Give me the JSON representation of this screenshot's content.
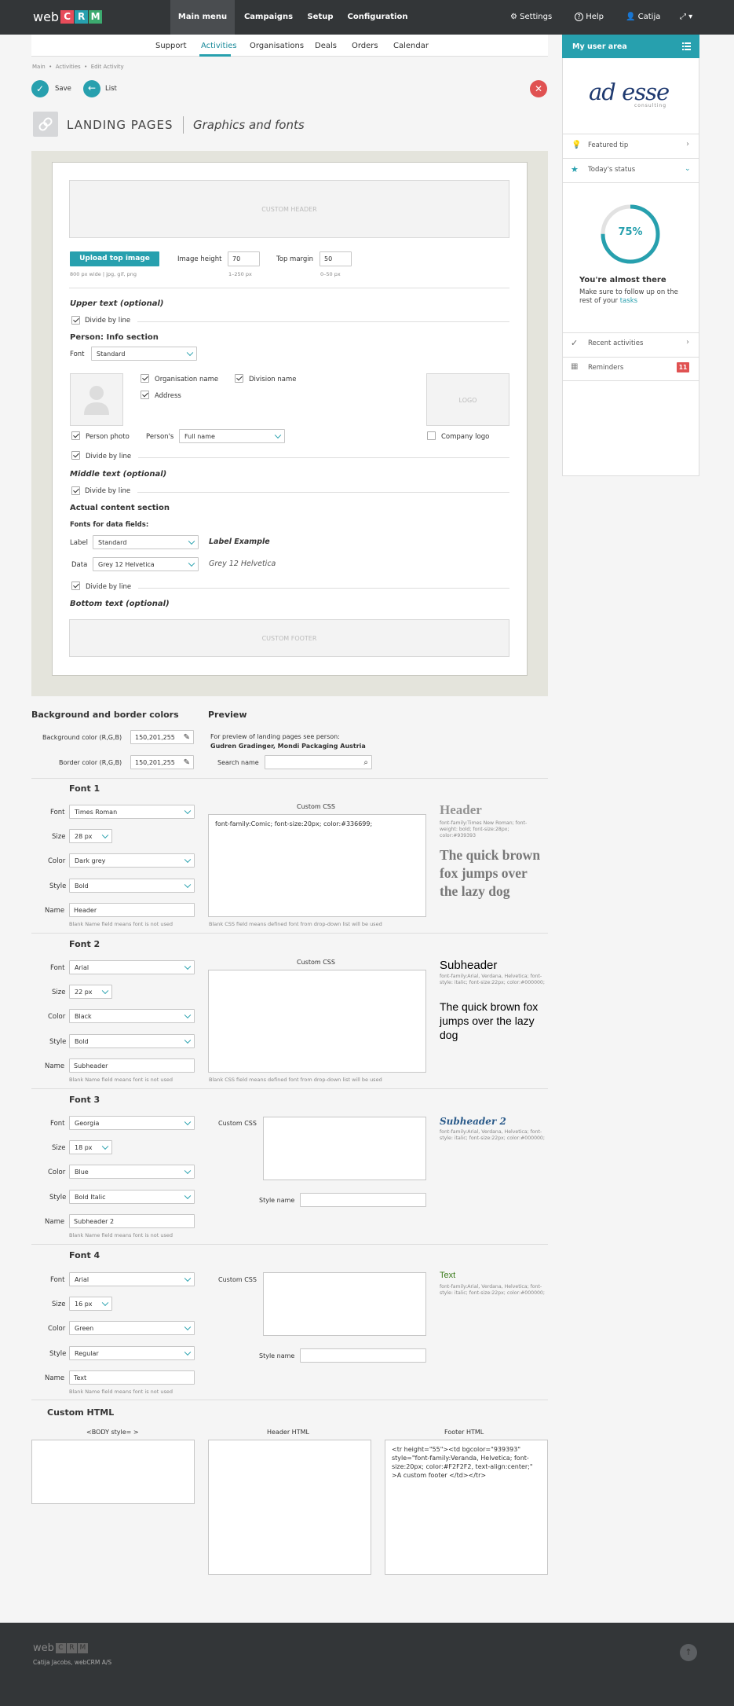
{
  "colors": {
    "accent": "#27a0ae",
    "danger": "#e05252",
    "brand_red": "#e74c5a",
    "brand_teal": "#27a0ae",
    "brand_green": "#3caa6f",
    "topbar": "#333638"
  },
  "topbar": {
    "logo_text": "web",
    "logo_letters": [
      "C",
      "R",
      "M"
    ],
    "nav": [
      "Main menu",
      "Campaigns",
      "Setup",
      "Configuration"
    ],
    "settings": "Settings",
    "help": "Help",
    "user": "Catija"
  },
  "subnav": [
    "Support",
    "Activities",
    "Organisations",
    "Deals",
    "Orders",
    "Calendar"
  ],
  "breadcrumb": [
    "Main",
    "Activities",
    "Edit Activity"
  ],
  "actions": {
    "save": "Save",
    "list": "List"
  },
  "page": {
    "title": "LANDING PAGES",
    "subtitle": "Graphics and fonts"
  },
  "template": {
    "custom_header": "CUSTOM HEADER",
    "upload_button": "Upload top image",
    "image_height_label": "Image height",
    "image_height": "70",
    "image_height_hint": "1–250 px",
    "top_margin_label": "Top margin",
    "top_margin": "50",
    "top_margin_hint": "0–50 px",
    "image_hint": "800 px wide  |  jpg, gif, png",
    "upper_text": "Upper text (optional)",
    "divide": "Divide by line",
    "person_info": "Person: Info section",
    "font_label": "Font",
    "font_value": "Standard",
    "org_name": "Organisation name",
    "division_name": "Division name",
    "address": "Address",
    "logo": "LOGO",
    "person_photo": "Person photo",
    "persons_label": "Person's",
    "persons_value": "Full name",
    "company_logo": "Company logo",
    "middle_text": "Middle text (optional)",
    "actual_content": "Actual content section",
    "fonts_for_data": "Fonts for data fields:",
    "label_label": "Label",
    "label_value": "Standard",
    "label_example": "Label Example",
    "data_label": "Data",
    "data_value": "Grey 12 Helvetica",
    "data_example": "Grey 12 Helvetica",
    "bottom_text": "Bottom text (optional)",
    "custom_footer": "CUSTOM FOOTER"
  },
  "colors_section": {
    "title": "Background and border colors",
    "bg_label": "Background color (R,G,B)",
    "bg_value": "150,201,255",
    "border_label": "Border color (R,G,B)",
    "border_value": "150,201,255"
  },
  "preview": {
    "title": "Preview",
    "text": "For preview of landing pages see person:",
    "person": "Gudren Gradinger, Mondi Packaging Austria",
    "search_label": "Search name",
    "search_value": ""
  },
  "labels": {
    "font": "Font",
    "size": "Size",
    "color": "Color",
    "style": "Style",
    "name": "Name",
    "custom_css": "Custom CSS",
    "style_name": "Style name",
    "name_hint": "Blank Name field means font is not used",
    "css_hint": "Blank CSS field means defined font from drop-down list will be used"
  },
  "fonts": [
    {
      "title": "Font 1",
      "font": "Times Roman",
      "size": "28 px",
      "color": "Dark grey",
      "style": "Bold",
      "name": "Header",
      "css": "font-family:Comic; font-size:20px; color:#336699;",
      "preview_title": "Header",
      "preview_meta": "font-family:Times New Roman; font-weight: bold; font-size:28px; color:#939393",
      "preview_sample": "The quick brown fox jumps over the lazy dog"
    },
    {
      "title": "Font 2",
      "font": "Arial",
      "size": "22 px",
      "color": "Black",
      "style": "Bold",
      "name": "Subheader",
      "css": "",
      "preview_title": "Subheader",
      "preview_meta": "font-family:Arial, Verdana, Helvetica; font-style: italic; font-size:22px; color:#000000;",
      "preview_sample": "The quick brown fox jumps over the lazy dog"
    },
    {
      "title": "Font 3",
      "font": "Georgia",
      "size": "18 px",
      "color": "Blue",
      "style": "Bold Italic",
      "name": "Subheader 2",
      "css": "",
      "style_name": "",
      "preview_title": "Subheader 2",
      "preview_meta": "font-family:Arial, Verdana, Helvetica; font-style: italic; font-size:22px; color:#000000;"
    },
    {
      "title": "Font 4",
      "font": "Arial",
      "size": "16 px",
      "color": "Green",
      "style": "Regular",
      "name": "Text",
      "css": "",
      "style_name": "",
      "preview_title": "Text",
      "preview_meta": "font-family:Arial, Verdana, Helvetica; font-style: italic; font-size:22px; color:#000000;"
    }
  ],
  "custom_html": {
    "title": "Custom HTML",
    "body_label": "<BODY style=   >",
    "header_label": "Header HTML",
    "footer_label": "Footer HTML",
    "body_value": "",
    "header_value": "",
    "footer_value": "<tr height=\"55\"><td bgcolor=\"939393\" style=\"font-family:Veranda, Helvetica; font-size:20px; color:#F2F2F2, text-align:center;\" >A custom footer </td></tr>"
  },
  "sidebar": {
    "title": "My user area",
    "company_logo": "ad esse",
    "company_sub": "consulting",
    "featured_tip": "Featured tip",
    "todays_status": "Today's status",
    "progress_label": "75%",
    "progress": 0.75,
    "almost": "You're almost there",
    "follow": "Make sure to follow up on the rest of your",
    "tasks": "tasks",
    "recent": "Recent activities",
    "reminders": "Reminders",
    "reminders_count": "11"
  },
  "footer": {
    "logo_text": "web",
    "logo_letters": [
      "C",
      "R",
      "M"
    ],
    "credit": "Catija Jacobs,  webCRM A/S"
  }
}
